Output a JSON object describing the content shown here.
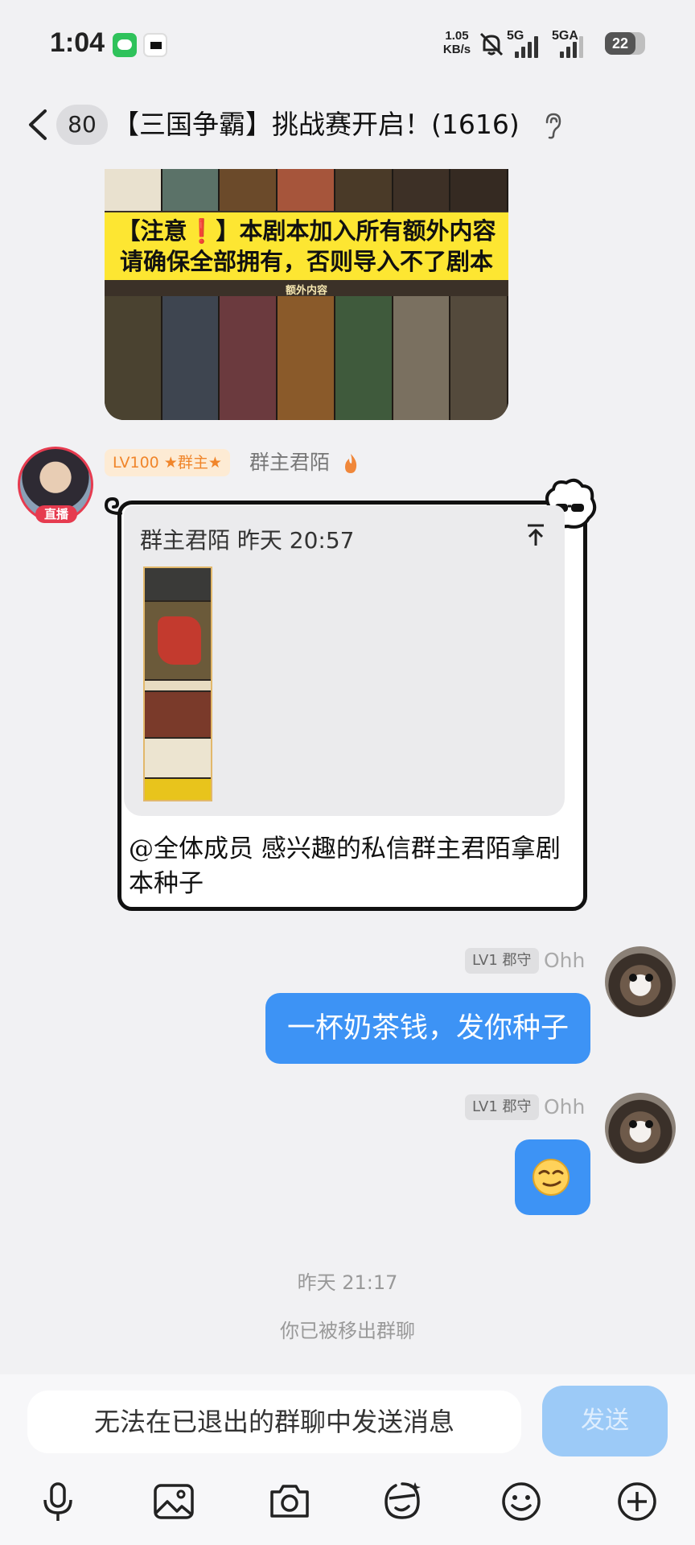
{
  "status_bar": {
    "time": "1:04",
    "net_speed_value": "1.05",
    "net_speed_unit": "KB/s",
    "sim1_label": "5G",
    "sim2_label": "5GA",
    "battery": "22"
  },
  "header": {
    "unread_badge": "80",
    "title": "【三国争霸】挑战赛开启！(1616)"
  },
  "banner_image": {
    "line1": "【注意❗】本剧本加入所有额外内容",
    "line2": "请确保全部拥有，否则导入不了剧本",
    "caption": "额外内容"
  },
  "message_owner": {
    "avatar_tag": "直播",
    "level_badge": "LV100 ★群主★",
    "sender_name": "群主君陌",
    "quote_header": "群主君陌 昨天 20:57",
    "text": "@全体成员 感兴趣的私信群主君陌拿剧本种子"
  },
  "message_reply1": {
    "level_badge": "LV1 郡守",
    "sender_name": "Ohh",
    "text": "一杯奶茶钱，发你种子"
  },
  "message_reply2": {
    "level_badge": "LV1 郡守",
    "sender_name": "Ohh"
  },
  "system": {
    "timestamp": "昨天 21:17",
    "notice": "你已被移出群聊"
  },
  "input": {
    "placeholder": "无法在已退出的群聊中发送消息",
    "send_label": "发送"
  },
  "toolbar_icons": [
    "mic-icon",
    "image-icon",
    "camera-icon",
    "sticker-icon",
    "emoji-icon",
    "plus-icon"
  ],
  "colors": {
    "bubble_blue": "#3d93f5",
    "send_disabled": "#9ccaf7",
    "owner_badge": "#f0852a",
    "live_red": "#e63b4f"
  }
}
